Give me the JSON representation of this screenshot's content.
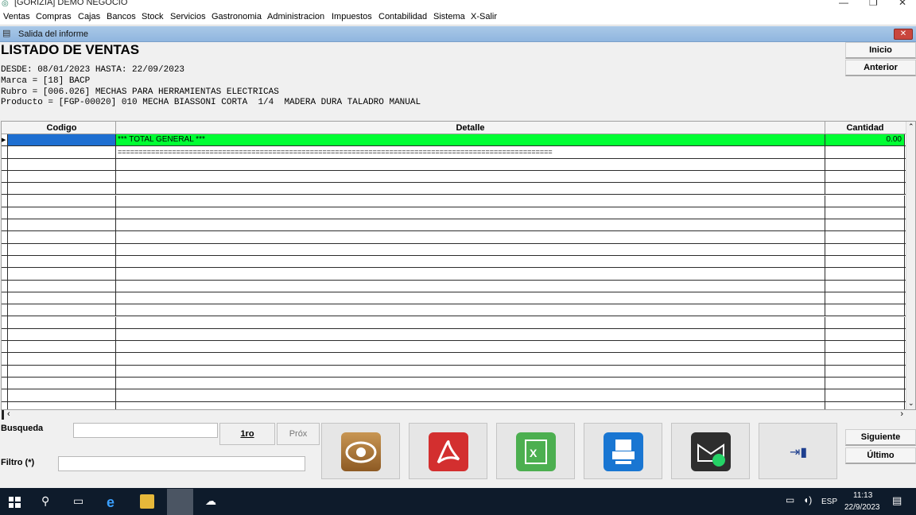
{
  "window": {
    "title": "[GORIZIA] DEMO NEGOCIO"
  },
  "menu": [
    "Ventas",
    "Compras",
    "Cajas",
    "Bancos",
    "Stock",
    "Servicios",
    "Gastronomia",
    "Administracion",
    "Impuestos",
    "Contabilidad",
    "Sistema",
    "X-Salir"
  ],
  "child_window": {
    "title": "Salida del informe"
  },
  "report": {
    "title": "LISTADO DE VENTAS",
    "lines": [
      "DESDE: 08/01/2023 HASTA: 22/09/2023",
      "Marca = [18] BACP",
      "Rubro = [006.026] MECHAS PARA HERRAMIENTAS ELECTRICAS",
      "Producto = [FGP-00020] 010 MECHA BIASSONI CORTA  1/4  MADERA DURA TALADRO MANUAL"
    ]
  },
  "side_buttons": {
    "inicio": "Inicio",
    "anterior": "Anterior",
    "siguiente": "Siguiente",
    "ultimo": "Último"
  },
  "table": {
    "columns": [
      "Codigo",
      "Detalle",
      "Cantidad"
    ],
    "rows": [
      {
        "codigo": "",
        "detalle": "*** TOTAL GENERAL ***",
        "cantidad": "0.00"
      },
      {
        "codigo": "",
        "detalle": "========================================================================================================",
        "cantidad": ""
      }
    ]
  },
  "search": {
    "label": "Busqueda",
    "value": "",
    "filter_label": "Filtro (*)",
    "filter_value": ""
  },
  "nav": {
    "first": "1ro",
    "next": "Próx"
  },
  "colors": {
    "highlight_row": "#00ff33",
    "selected_cell": "#1e6fd1",
    "pdf": "#d32f2f",
    "excel": "#4caf50",
    "print": "#1976d2"
  },
  "taskbar": {
    "time": "11:13",
    "date": "22/9/2023",
    "lang": "ESP"
  }
}
